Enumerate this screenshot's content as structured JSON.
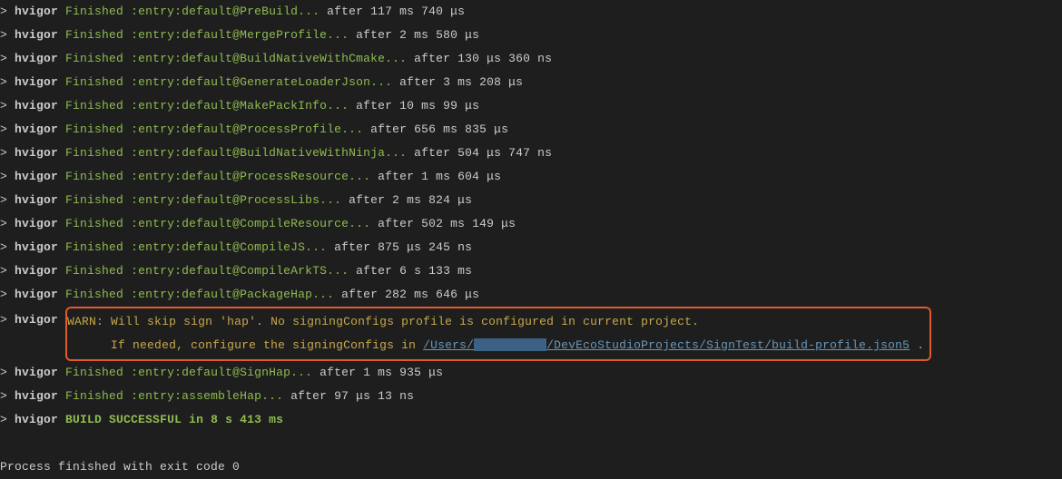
{
  "prompt": ">",
  "tool": "hvigor",
  "lines": [
    {
      "status": "Finished",
      "task": ":entry:default@PreBuild...",
      "after": "after 117 ms 740 μs"
    },
    {
      "status": "Finished",
      "task": ":entry:default@MergeProfile...",
      "after": "after 2 ms 580 μs"
    },
    {
      "status": "Finished",
      "task": ":entry:default@BuildNativeWithCmake...",
      "after": "after 130 μs 360 ns"
    },
    {
      "status": "Finished",
      "task": ":entry:default@GenerateLoaderJson...",
      "after": "after 3 ms 208 μs"
    },
    {
      "status": "Finished",
      "task": ":entry:default@MakePackInfo...",
      "after": "after 10 ms 99 μs"
    },
    {
      "status": "Finished",
      "task": ":entry:default@ProcessProfile...",
      "after": "after 656 ms 835 μs"
    },
    {
      "status": "Finished",
      "task": ":entry:default@BuildNativeWithNinja...",
      "after": "after 504 μs 747 ns"
    },
    {
      "status": "Finished",
      "task": ":entry:default@ProcessResource...",
      "after": "after 1 ms 604 μs"
    },
    {
      "status": "Finished",
      "task": ":entry:default@ProcessLibs...",
      "after": "after 2 ms 824 μs"
    },
    {
      "status": "Finished",
      "task": ":entry:default@CompileResource...",
      "after": "after 502 ms 149 μs"
    },
    {
      "status": "Finished",
      "task": ":entry:default@CompileJS...",
      "after": "after 875 μs 245 ns"
    },
    {
      "status": "Finished",
      "task": ":entry:default@CompileArkTS...",
      "after": "after 6 s 133 ms"
    },
    {
      "status": "Finished",
      "task": ":entry:default@PackageHap...",
      "after": "after 282 ms 646 μs"
    }
  ],
  "warn": {
    "line1": "WARN: Will skip sign 'hap'. No signingConfigs profile is configured in current project.",
    "line2_prefix": "      If needed, configure the signingConfigs in ",
    "link_pre": "/Users/",
    "link_post": "/DevEcoStudioProjects/SignTest/build-profile.json5",
    "line2_suffix": " ."
  },
  "lines_after": [
    {
      "status": "Finished",
      "task": ":entry:default@SignHap...",
      "after": "after 1 ms 935 μs"
    },
    {
      "status": "Finished",
      "task": ":entry:assembleHap...",
      "after": "after 97 μs 13 ns"
    }
  ],
  "build_success": "BUILD SUCCESSFUL in 8 s 413 ms",
  "exit": "Process finished with exit code 0"
}
